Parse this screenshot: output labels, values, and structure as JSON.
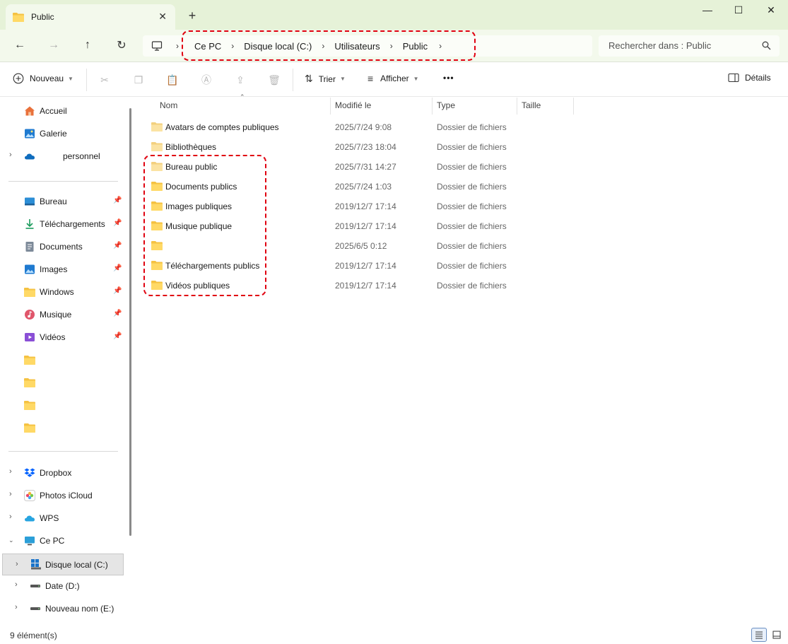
{
  "window": {
    "tab_title": "Public",
    "tab_close": "✕",
    "new_tab": "+",
    "minimize": "—",
    "maximize": "☐",
    "close": "✕"
  },
  "nav": {
    "back": "←",
    "forward": "→",
    "up": "↑",
    "refresh": "↻",
    "breadcrumb": [
      "Ce PC",
      "Disque local (C:)",
      "Utilisateurs",
      "Public"
    ],
    "search_placeholder": "Rechercher dans : Public"
  },
  "toolbar": {
    "new_label": "Nouveau",
    "sort_label": "Trier",
    "view_label": "Afficher",
    "more_label": "•••",
    "details_label": "Détails"
  },
  "columns": {
    "name": "Nom",
    "modified": "Modifié le",
    "type": "Type",
    "size": "Taille"
  },
  "files": [
    {
      "name": "Avatars de comptes publiques",
      "modified": "2025/7/24 9:08",
      "type": "Dossier de fichiers",
      "pale": true
    },
    {
      "name": "Bibliothèques",
      "modified": "2025/7/23 18:04",
      "type": "Dossier de fichiers",
      "pale": true
    },
    {
      "name": "Bureau public",
      "modified": "2025/7/31 14:27",
      "type": "Dossier de fichiers",
      "pale": true
    },
    {
      "name": "Documents publics",
      "modified": "2025/7/24 1:03",
      "type": "Dossier de fichiers",
      "pale": false
    },
    {
      "name": "Images publiques",
      "modified": "2019/12/7 17:14",
      "type": "Dossier de fichiers",
      "pale": false
    },
    {
      "name": "Musique publique",
      "modified": "2019/12/7 17:14",
      "type": "Dossier de fichiers",
      "pale": false
    },
    {
      "name": "",
      "modified": "2025/6/5 0:12",
      "type": "Dossier de fichiers",
      "pale": false
    },
    {
      "name": "Téléchargements publics",
      "modified": "2019/12/7 17:14",
      "type": "Dossier de fichiers",
      "pale": false
    },
    {
      "name": "Vidéos publiques",
      "modified": "2019/12/7 17:14",
      "type": "Dossier de fichiers",
      "pale": false
    }
  ],
  "sidebar": {
    "top": [
      {
        "label": "Accueil",
        "icon": "home-icon"
      },
      {
        "label": "Galerie",
        "icon": "gallery-icon"
      },
      {
        "label": "personnel",
        "icon": "onedrive-icon"
      }
    ],
    "pinned": [
      {
        "label": "Bureau",
        "icon": "desktop-icon"
      },
      {
        "label": "Téléchargements",
        "icon": "download-icon"
      },
      {
        "label": "Documents",
        "icon": "documents-icon"
      },
      {
        "label": "Images",
        "icon": "images-icon"
      },
      {
        "label": "Windows",
        "icon": "folder-icon"
      },
      {
        "label": "Musique",
        "icon": "music-icon"
      },
      {
        "label": "Vidéos",
        "icon": "videos-icon"
      }
    ],
    "drives": [
      {
        "label": "Dropbox",
        "icon": "dropbox-icon"
      },
      {
        "label": "Photos iCloud",
        "icon": "icloud-photos-icon"
      },
      {
        "label": "WPS",
        "icon": "wps-cloud-icon"
      },
      {
        "label": "Ce PC",
        "icon": "pc-icon"
      },
      {
        "label": "Disque local (C:)",
        "icon": "windows-drive-icon"
      },
      {
        "label": "Date (D:)",
        "icon": "drive-icon"
      },
      {
        "label": "Nouveau nom (E:)",
        "icon": "drive-icon"
      }
    ]
  },
  "status": {
    "count": "9 élément(s)"
  },
  "colors": {
    "accent_green": "#e6f2d8",
    "folder_yellow": "#f5c242",
    "highlight_red": "#e00010"
  }
}
